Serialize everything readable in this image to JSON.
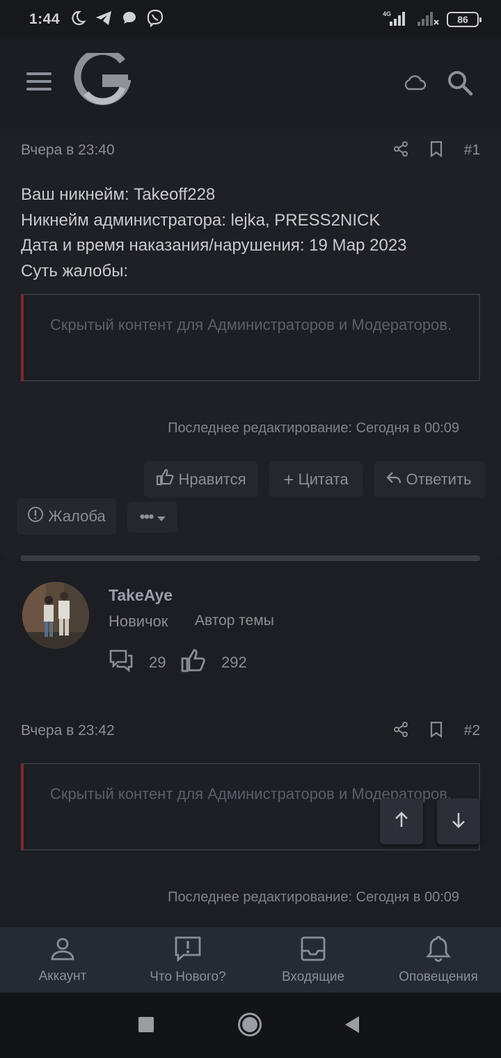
{
  "status_bar": {
    "time": "1:44",
    "network_label": "4G",
    "battery": "86"
  },
  "app_bar": {
    "menu_icon": "hamburger-icon",
    "logo_icon": "site-logo-g",
    "cloud_icon": "cloud-icon",
    "search_icon": "search-icon"
  },
  "post1": {
    "date": "Вчера в 23:40",
    "number": "#1",
    "lines": [
      "Ваш никнейм: Takeoff228",
      "Никнейм администратора: lejka, PRESS2NICK",
      "Дата и время наказания/нарушения: 19 Мар 2023",
      "Суть жалобы:"
    ],
    "hidden_text": "Скрытый контент для Администраторов и Модераторов.",
    "edited": "Последнее редактирование: Сегодня в 00:09",
    "actions": {
      "like": "Нравится",
      "quote": "Цитата",
      "reply": "Ответить",
      "report": "Жалоба"
    }
  },
  "author": {
    "name": "TakeAye",
    "role": "Новичок",
    "badge": "Автор темы",
    "messages": "29",
    "likes": "292"
  },
  "post2": {
    "date": "Вчера в 23:42",
    "number": "#2",
    "hidden_text": "Скрытый контент для Администраторов и Модераторов.",
    "edited": "Последнее редактирование: Сегодня в 00:09"
  },
  "bottom_nav": [
    {
      "label": "Аккаунт",
      "icon": "user-icon"
    },
    {
      "label": "Что Нового?",
      "icon": "news-icon"
    },
    {
      "label": "Входящие",
      "icon": "inbox-icon"
    },
    {
      "label": "Оповещения",
      "icon": "bell-icon"
    }
  ],
  "colors": {
    "background": "#1c1e24",
    "accent_border": "#7a2a2e",
    "text": "#c8cad0",
    "muted": "#8a8e96"
  }
}
